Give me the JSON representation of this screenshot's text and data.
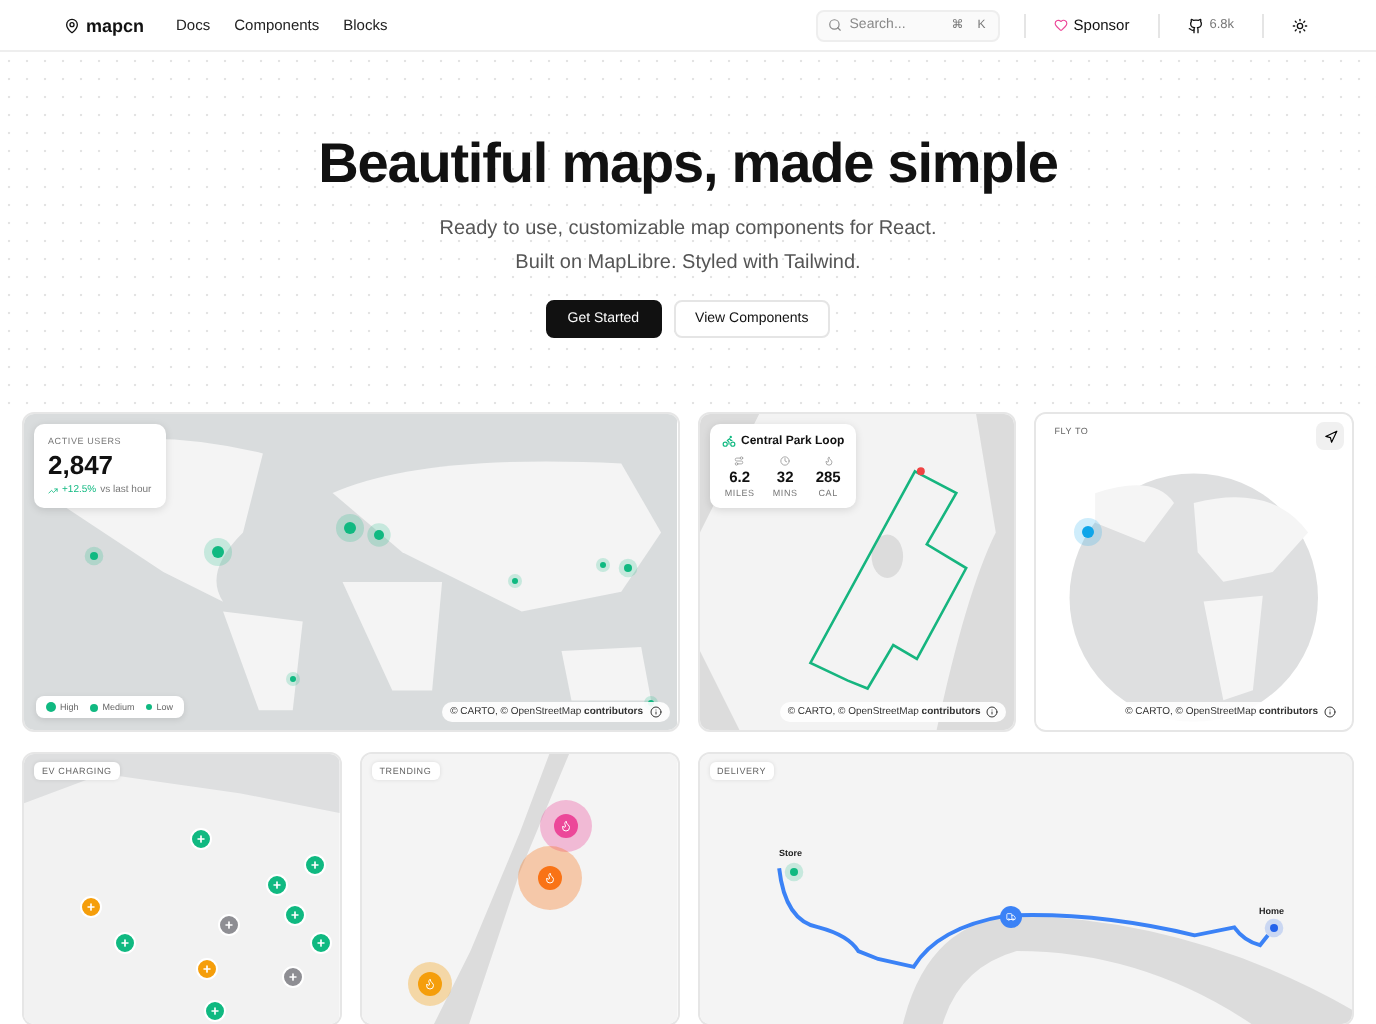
{
  "nav": {
    "brand": "mapcn",
    "links": [
      "Docs",
      "Components",
      "Blocks"
    ],
    "search": {
      "placeholder": "Search..."
    },
    "shortcut": [
      "⌘",
      "K"
    ],
    "sponsor": "Sponsor",
    "stars": "6.8k"
  },
  "hero": {
    "title": "Beautiful maps, made simple",
    "subtitle": [
      "Ready to use, customizable map components for React.",
      "Built on MapLibre. Styled with Tailwind."
    ],
    "buttons": [
      {
        "label": "Get Started",
        "kind": "primary"
      },
      {
        "label": "View Components",
        "kind": "secondary"
      }
    ]
  },
  "cards": [
    {
      "kind": "world",
      "stats": {
        "label": "ACTIVE USERS",
        "value": "2,847",
        "change": "+12.5%",
        "note": "vs last hour"
      },
      "legend": [
        "High",
        "Medium",
        "Low"
      ],
      "attribution": "© CARTO, © OpenStreetMap **contributors**"
    },
    {
      "kind": "route",
      "title": "Central Park Loop",
      "stats": [
        {
          "value": "6.2",
          "label": "MILES"
        },
        {
          "value": "32",
          "label": "MINS"
        },
        {
          "value": "285",
          "label": "CAL"
        }
      ],
      "attribution": "© CARTO, © OpenStreetMap **contributors**"
    },
    {
      "kind": "globe",
      "label": "FLY TO",
      "attribution": "© CARTO, © OpenStreetMap **contributors**"
    },
    {
      "kind": "ev",
      "label": "EV CHARGING",
      "stations": [
        {
          "color": "#10b981"
        },
        {
          "color": "#10b981"
        },
        {
          "color": "#10b981"
        },
        {
          "color": "#f59e0b"
        },
        {
          "color": "#10b981"
        },
        {
          "color": "#8e8e93"
        },
        {
          "color": "#10b981"
        },
        {
          "color": "#10b981"
        },
        {
          "color": "#f59e0b"
        },
        {
          "color": "#8e8e93"
        },
        {
          "color": "#10b981"
        }
      ]
    },
    {
      "kind": "trending",
      "label": "TRENDING",
      "hotspots": [
        {
          "color": "#ec4899"
        },
        {
          "color": "#f97316"
        },
        {
          "color": "#f59e0b"
        }
      ]
    },
    {
      "kind": "delivery",
      "label": "DELIVERY",
      "start": "Store",
      "end": "Home"
    }
  ]
}
